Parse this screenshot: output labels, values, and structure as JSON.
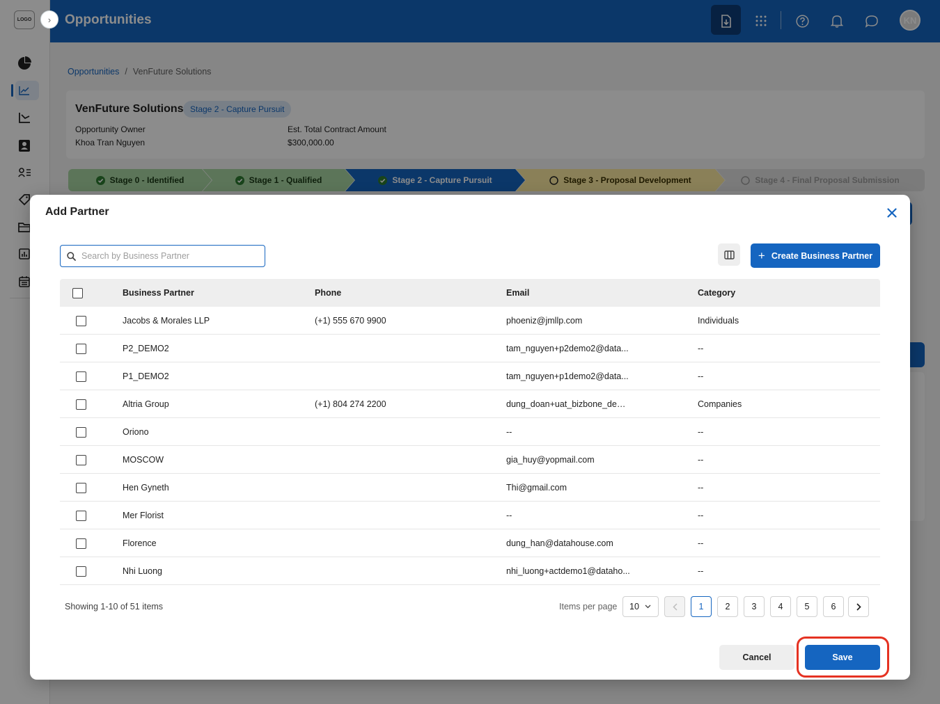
{
  "app": {
    "logo_text": "LOGO",
    "title": "Opportunities",
    "avatar_initials": "KN",
    "accent_color": "#1565c0"
  },
  "sidebar": {
    "icons": [
      "pie-chart-icon",
      "trend-chart-icon",
      "sales-chart-icon",
      "contacts-book-icon",
      "user-list-icon",
      "tag-icon",
      "folder-icon",
      "report-icon",
      "calendar-icon"
    ]
  },
  "topbar_icons": [
    "download-icon",
    "apps-grid-icon",
    "help-icon",
    "bell-icon",
    "chat-icon"
  ],
  "breadcrumb": {
    "root": "Opportunities",
    "separator": "/",
    "current": "VenFuture Solutions"
  },
  "opportunity": {
    "name": "VenFuture Solutions",
    "stage_badge": "Stage 2 - Capture Pursuit",
    "owner_label": "Opportunity Owner",
    "owner_value": "Khoa Tran Nguyen",
    "amount_label": "Est. Total Contract Amount",
    "amount_value": "$300,000.00"
  },
  "stages": [
    {
      "label": "Stage 0 - Identified",
      "status": "done"
    },
    {
      "label": "Stage 1 - Qualified",
      "status": "done"
    },
    {
      "label": "Stage 2 - Capture Pursuit",
      "status": "current"
    },
    {
      "label": "Stage 3 - Proposal Development",
      "status": "next"
    },
    {
      "label": "Stage 4 - Final Proposal Submission",
      "status": "future"
    }
  ],
  "modal": {
    "title": "Add Partner",
    "search_placeholder": "Search by Business Partner",
    "create_button": "Create Business Partner",
    "columns": {
      "business_partner": "Business Partner",
      "phone": "Phone",
      "email": "Email",
      "category": "Category"
    },
    "rows": [
      {
        "name": "Jacobs & Morales LLP",
        "phone": "(+1) 555 670 9900",
        "email": "phoeniz@jmllp.com",
        "category": "Individuals"
      },
      {
        "name": "P2_DEMO2",
        "phone": "",
        "email": "tam_nguyen+p2demo2@data...",
        "category": "--"
      },
      {
        "name": "P1_DEMO2",
        "phone": "",
        "email": "tam_nguyen+p1demo2@data...",
        "category": "--"
      },
      {
        "name": "Altria Group",
        "phone": "(+1) 804 274 2200",
        "email": "dung_doan+uat_bizbone_dem...",
        "category": "Companies"
      },
      {
        "name": "Oriono",
        "phone": "",
        "email": "--",
        "category": "--"
      },
      {
        "name": "MOSCOW",
        "phone": "",
        "email": "gia_huy@yopmail.com",
        "category": "--"
      },
      {
        "name": "Hen Gyneth",
        "phone": "",
        "email": "Thi@gmail.com",
        "category": "--"
      },
      {
        "name": "Mer Florist",
        "phone": "",
        "email": "--",
        "category": "--"
      },
      {
        "name": "Florence",
        "phone": "",
        "email": "dung_han@datahouse.com",
        "category": "--"
      },
      {
        "name": "Nhi Luong",
        "phone": "",
        "email": "nhi_luong+actdemo1@dataho...",
        "category": "--"
      }
    ],
    "showing_text": "Showing 1-10 of 51 items",
    "items_per_page_label": "Items per page",
    "items_per_page_value": "10",
    "pages": [
      "1",
      "2",
      "3",
      "4",
      "5",
      "6"
    ],
    "current_page": "1",
    "cancel_label": "Cancel",
    "save_label": "Save",
    "highlight_color": "#e53222"
  }
}
